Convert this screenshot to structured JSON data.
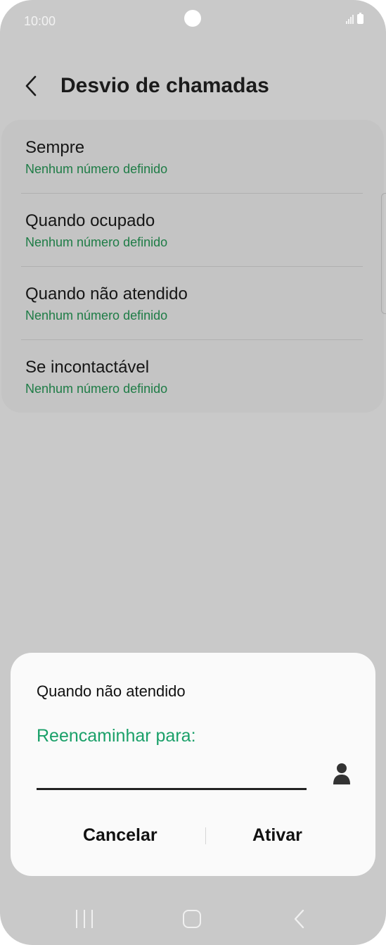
{
  "status_bar": {
    "time": "10:00"
  },
  "header": {
    "title": "Desvio de chamadas"
  },
  "options": [
    {
      "title": "Sempre",
      "subtitle": "Nenhum número definido"
    },
    {
      "title": "Quando ocupado",
      "subtitle": "Nenhum número definido"
    },
    {
      "title": "Quando não atendido",
      "subtitle": "Nenhum número definido"
    },
    {
      "title": "Se incontactável",
      "subtitle": "Nenhum número definido"
    }
  ],
  "dialog": {
    "title": "Quando não atendido",
    "field_label": "Reencaminhar para:",
    "field_value": "",
    "cancel_label": "Cancelar",
    "confirm_label": "Ativar"
  },
  "colors": {
    "accent_green": "#1aa069",
    "subtitle_green": "#1e7c46",
    "scrim_background": "#c9c9c9"
  },
  "icons": {
    "back": "chevron-left-icon",
    "contact": "person-icon",
    "nav_recents": "recents-icon",
    "nav_home": "home-icon",
    "nav_back": "back-icon"
  }
}
